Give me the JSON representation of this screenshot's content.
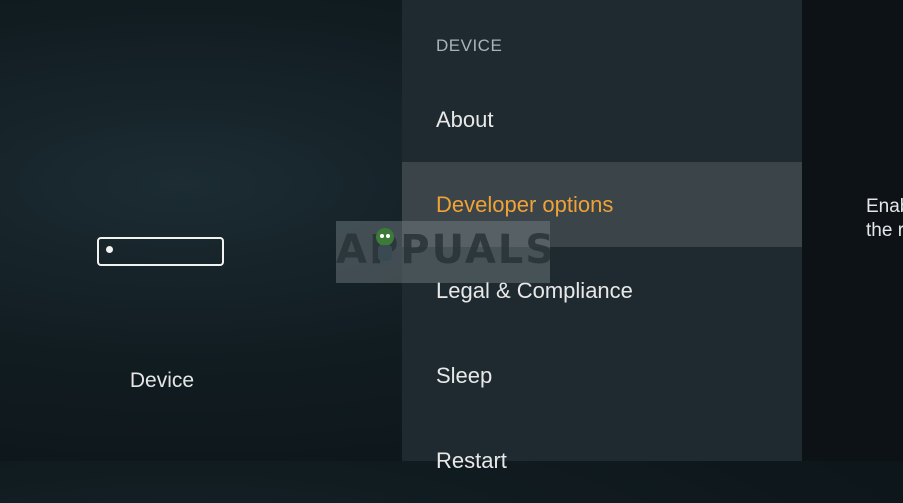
{
  "left": {
    "device_label": "Device"
  },
  "menu": {
    "header": "DEVICE",
    "items": [
      {
        "label": "About"
      },
      {
        "label": "Developer options"
      },
      {
        "label": "Legal & Compliance"
      },
      {
        "label": "Sleep"
      },
      {
        "label": "Restart"
      }
    ],
    "selected": "Developer options"
  },
  "description": {
    "line1": "Enab",
    "line2": "the r"
  },
  "watermark": {
    "text": "APPUALS"
  },
  "colors": {
    "selected_text": "#f0a236",
    "selected_bg": "#3b4449",
    "menu_bg": "#1f2a30"
  }
}
